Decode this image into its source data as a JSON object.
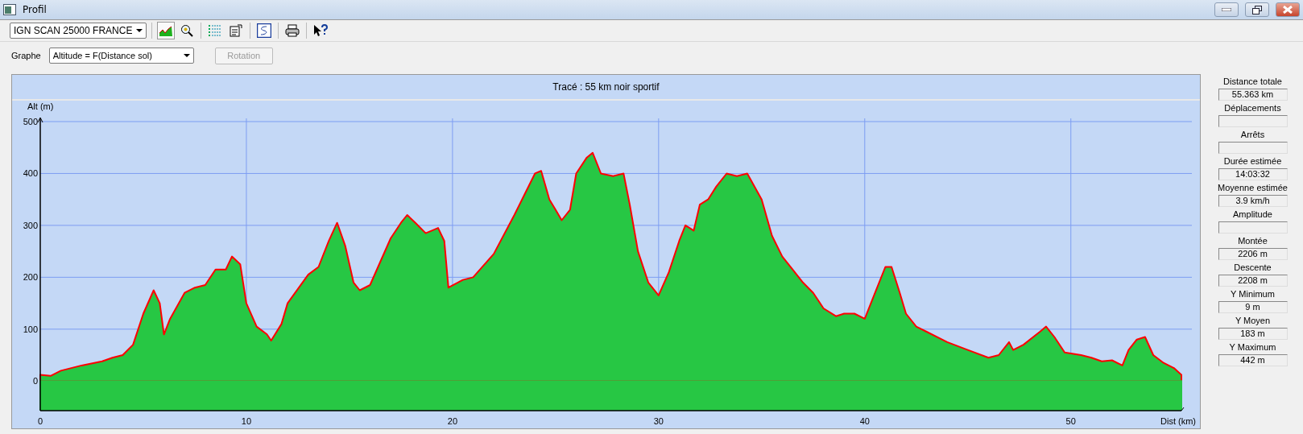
{
  "window": {
    "title": "Profil"
  },
  "toolbar": {
    "map_select": "IGN SCAN 25000 FRANCE",
    "tools": [
      {
        "kind": "profile",
        "selected": true
      },
      {
        "kind": "zoom",
        "selected": false
      },
      {
        "kind": "list",
        "selected": false
      },
      {
        "kind": "properties",
        "selected": false
      },
      {
        "kind": "curve",
        "selected": false
      },
      {
        "kind": "print",
        "selected": false
      },
      {
        "kind": "help",
        "selected": false
      }
    ]
  },
  "graph": {
    "label": "Graphe",
    "select": "Altitude = F(Distance sol)",
    "rotation_button": {
      "label": "Rotation",
      "disabled": true
    }
  },
  "profile": {
    "title": "Tracé : 55 km noir sportif",
    "chart_data": {
      "type": "area",
      "grid": true,
      "xlabel": "Dist (km)",
      "ylabel": "Alt (m)",
      "xlim": [
        0,
        55.363
      ],
      "ylim": [
        -57,
        500
      ],
      "xticks": [
        0,
        10,
        20,
        30,
        40,
        50
      ],
      "yticks": [
        0,
        100,
        200,
        300,
        400,
        500
      ],
      "x": [
        0,
        0.5,
        1,
        2,
        3,
        3.5,
        4,
        4.5,
        5,
        5.5,
        5.8,
        6,
        6.3,
        7,
        7.5,
        8,
        8.5,
        9,
        9.3,
        9.7,
        10,
        10.5,
        11,
        11.2,
        11.7,
        12,
        13,
        13.5,
        14,
        14.4,
        14.8,
        15.2,
        15.5,
        16,
        16.5,
        17,
        17.5,
        17.8,
        18.2,
        18.7,
        19.3,
        19.6,
        19.8,
        20.5,
        21,
        22,
        23,
        23.5,
        24,
        24.3,
        24.7,
        25,
        25.3,
        25.7,
        26,
        26.5,
        26.8,
        27.2,
        27.8,
        28.3,
        28.6,
        29,
        29.5,
        30,
        30.5,
        31,
        31.3,
        31.7,
        32,
        32.4,
        32.8,
        33.3,
        33.8,
        34.3,
        35,
        35.5,
        36,
        36.5,
        37,
        37.5,
        38,
        38.6,
        39,
        39.5,
        40,
        40.5,
        41,
        41.3,
        41.7,
        42,
        42.5,
        43,
        44,
        45,
        46,
        46.5,
        47,
        47.2,
        47.7,
        48.5,
        48.8,
        49.2,
        49.7,
        50.5,
        51,
        51.5,
        52,
        52.5,
        52.8,
        53.2,
        53.6,
        54,
        54.5,
        55,
        55.363
      ],
      "series": [
        {
          "color": "#27c744",
          "values": [
            12,
            10,
            20,
            30,
            38,
            45,
            50,
            70,
            130,
            175,
            150,
            90,
            120,
            170,
            180,
            185,
            215,
            215,
            240,
            225,
            150,
            105,
            90,
            78,
            110,
            150,
            205,
            220,
            270,
            305,
            260,
            190,
            175,
            185,
            230,
            275,
            305,
            320,
            305,
            285,
            295,
            270,
            180,
            195,
            200,
            245,
            320,
            360,
            400,
            405,
            350,
            330,
            310,
            330,
            400,
            430,
            440,
            400,
            395,
            400,
            340,
            250,
            190,
            165,
            210,
            270,
            300,
            290,
            340,
            350,
            375,
            400,
            395,
            400,
            350,
            280,
            240,
            215,
            190,
            170,
            140,
            125,
            130,
            130,
            120,
            170,
            220,
            220,
            170,
            130,
            105,
            95,
            75,
            60,
            45,
            50,
            75,
            60,
            70,
            95,
            105,
            85,
            55,
            50,
            45,
            38,
            40,
            30,
            60,
            80,
            85,
            50,
            35,
            25,
            12
          ]
        }
      ]
    }
  },
  "stats": [
    {
      "label": "Distance totale",
      "value": "55.363 km"
    },
    {
      "label": "Déplacements"
    },
    {
      "label": "Arrêts"
    },
    {
      "label": "Durée estimée",
      "value": "14:03:32"
    },
    {
      "label": "Moyenne estimée",
      "value": "3.9 km/h"
    },
    {
      "label": "Amplitude"
    },
    {
      "label": "Montée",
      "value": "2206 m"
    },
    {
      "label": "Descente",
      "value": "2208 m"
    },
    {
      "label": "Y Minimum",
      "value": "9 m"
    },
    {
      "label": "Y Moyen",
      "value": "183 m"
    },
    {
      "label": "Y Maximum",
      "value": "442 m"
    }
  ]
}
